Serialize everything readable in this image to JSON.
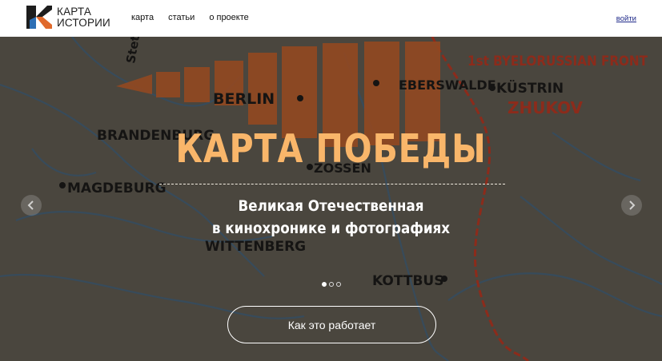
{
  "logo": {
    "line1": "КАРТА",
    "line2": "ИСТОРИИ"
  },
  "nav": {
    "items": [
      {
        "label": "карта"
      },
      {
        "label": "статьи"
      },
      {
        "label": "о проекте"
      }
    ]
  },
  "header": {
    "login_label": "войти"
  },
  "hero": {
    "title": "КАРТА ПОБЕДЫ",
    "subtitle_line1": "Великая Отечественная",
    "subtitle_line2": "в кинохронике и фотографиях",
    "cta_label": "Как это работает",
    "slides_total": 3,
    "active_slide": 1
  },
  "map": {
    "labels": {
      "berlin": "BERLIN",
      "brandenburg": "BRANDENBURG",
      "magdeburg": "MAGDEBURG",
      "wittenberg": "WITTENBERG",
      "kottbus": "KOTTBUS",
      "kustrin": "KÜSTRIN",
      "front": "1st BYELORUSSIAN FRONT",
      "zhukov": "ZHUKOV",
      "zossen": "ZOSSEN",
      "eberswalde": "EBERSWALDE",
      "stettin": "Stet"
    },
    "colors": {
      "background": "#5a564d",
      "arrows": "#e06a2c",
      "front_text": "#d53a22"
    }
  },
  "colors": {
    "title": "#f9b66a",
    "login": "#1f2a8a"
  }
}
